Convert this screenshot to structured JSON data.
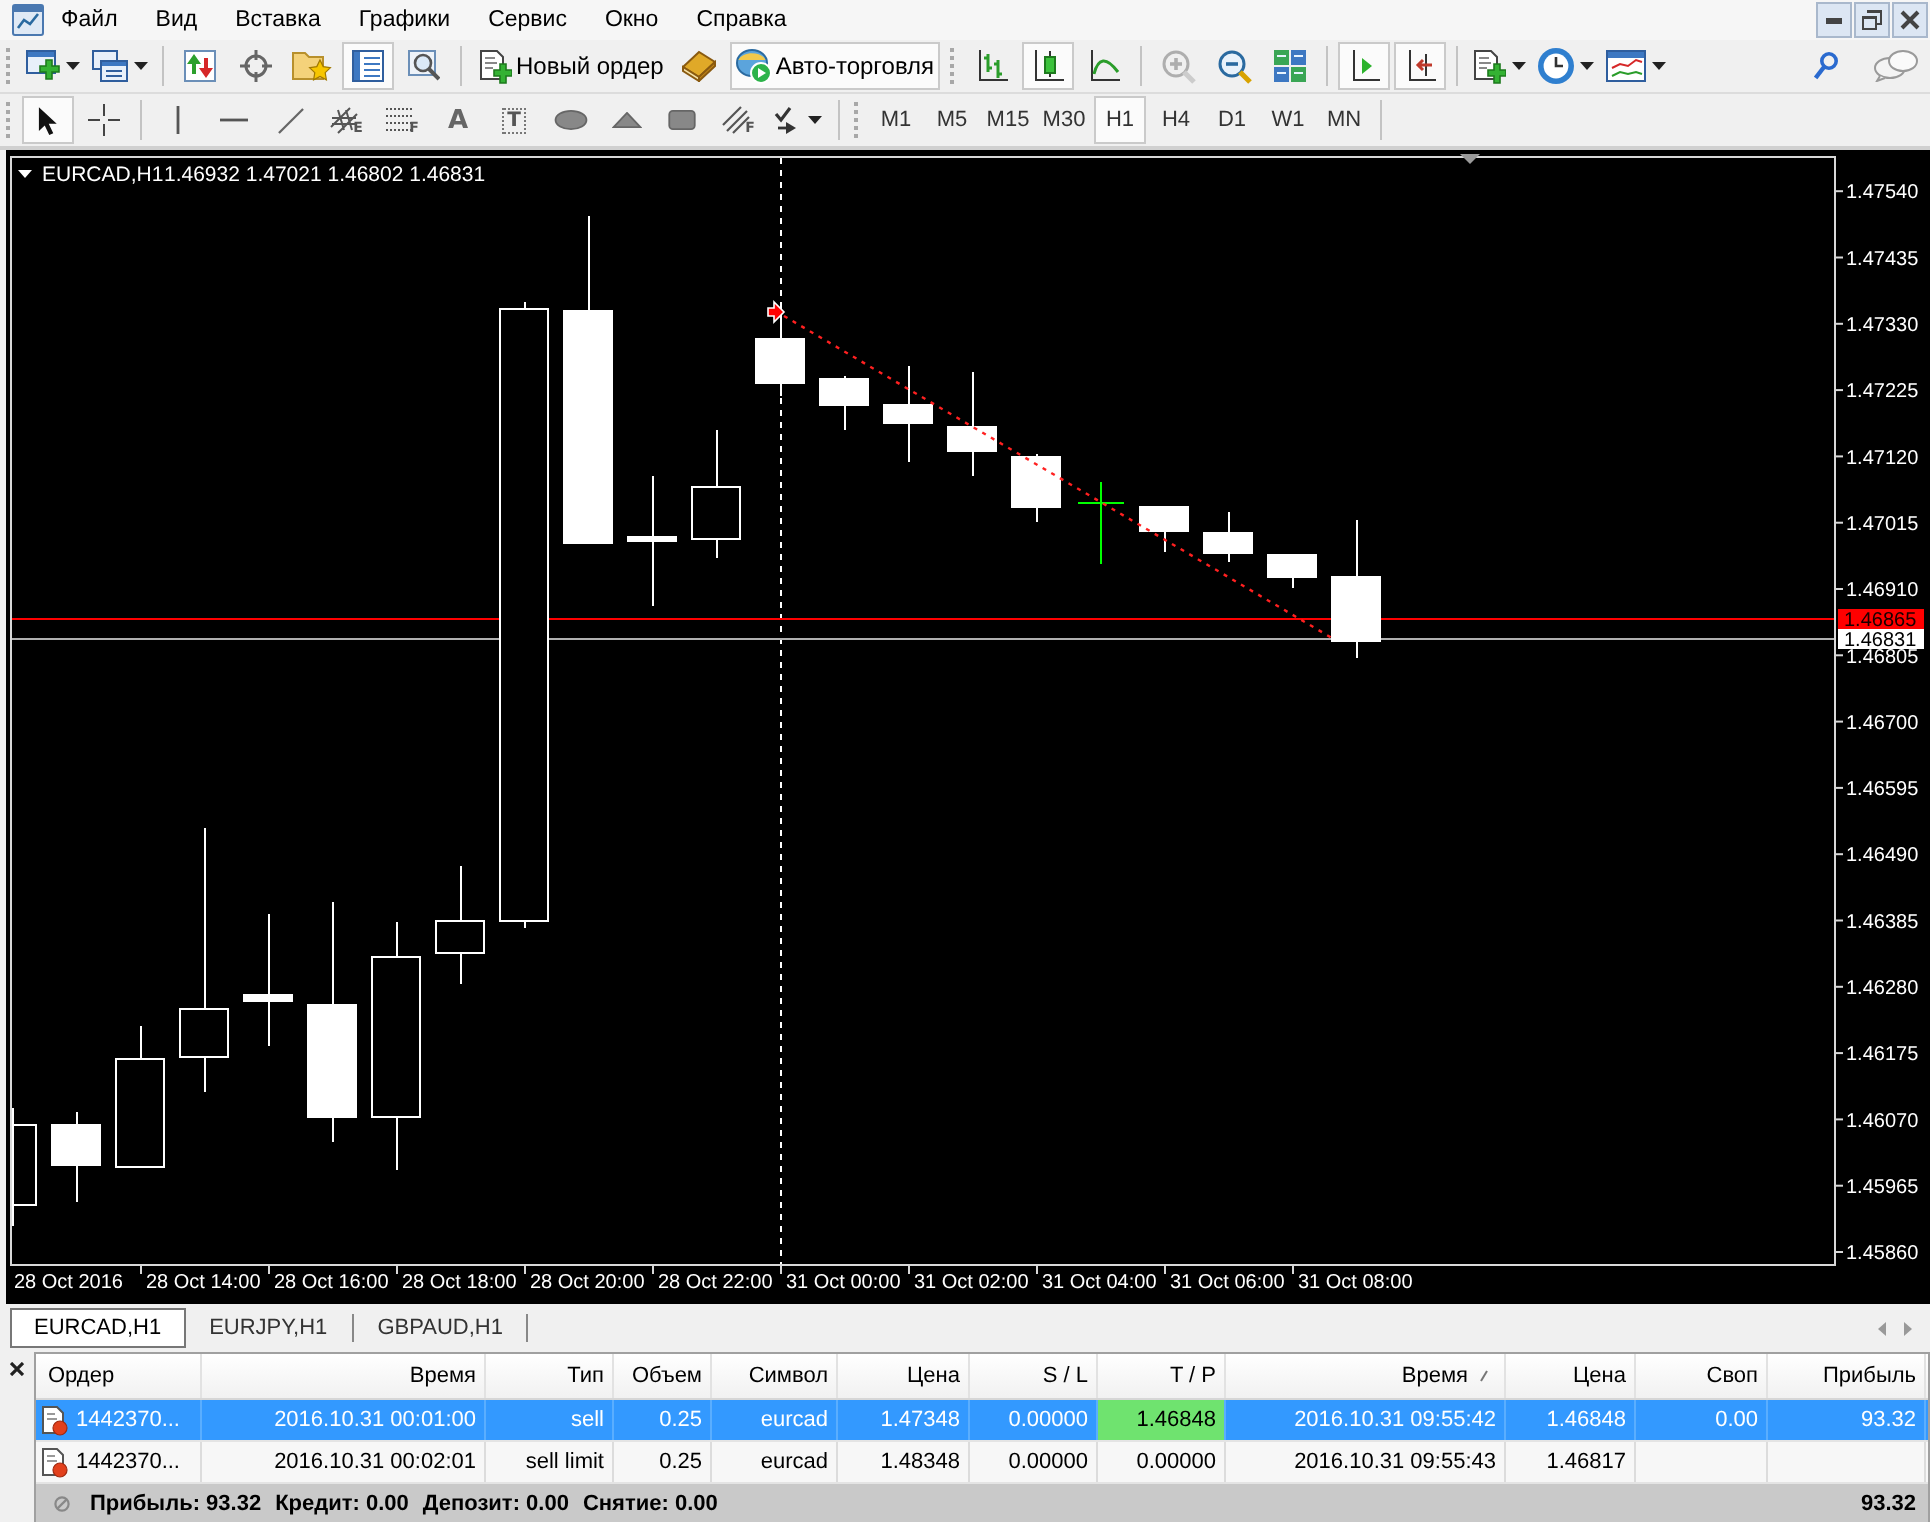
{
  "menu": [
    "Файл",
    "Вид",
    "Вставка",
    "Графики",
    "Сервис",
    "Окно",
    "Справка"
  ],
  "toolbar": {
    "items": [
      {
        "pressed": false,
        "disabled": false
      },
      {
        "pressed": false,
        "disabled": false
      },
      {
        "pressed": false,
        "disabled": false
      },
      {
        "pressed": false,
        "disabled": false
      },
      {
        "pressed": false,
        "disabled": false
      },
      {
        "pressed": true,
        "disabled": false
      },
      {
        "pressed": false,
        "disabled": false
      },
      {
        "label": "Новый ордер",
        "pressed": false,
        "disabled": false
      },
      {
        "pressed": false,
        "disabled": false
      },
      {
        "label": "Авто-торговля",
        "pressed": true,
        "disabled": false
      },
      {
        "pressed": false,
        "disabled": false
      },
      {
        "pressed": true,
        "disabled": false
      },
      {
        "pressed": false,
        "disabled": false
      },
      {
        "pressed": false,
        "disabled": true
      },
      {
        "pressed": false,
        "disabled": false
      },
      {
        "pressed": false,
        "disabled": false
      },
      {
        "pressed": true,
        "disabled": false
      },
      {
        "pressed": true,
        "disabled": false
      },
      {
        "pressed": false,
        "disabled": false
      },
      {
        "pressed": false,
        "disabled": false
      },
      {
        "pressed": false,
        "disabled": false
      }
    ]
  },
  "drawing_toolbar": {
    "items": [
      {
        "pressed": true
      },
      {
        "pressed": false
      },
      {
        "pressed": false
      },
      {
        "pressed": false
      },
      {
        "pressed": false
      },
      {
        "label": "E",
        "pressed": false
      },
      {
        "label": "F",
        "pressed": false
      },
      {
        "label": "A",
        "pressed": false
      },
      {
        "label": "T",
        "pressed": false
      },
      {
        "pressed": false
      },
      {
        "pressed": false
      },
      {
        "pressed": false
      },
      {
        "label": "F",
        "pressed": false
      },
      {
        "pressed": false
      }
    ]
  },
  "timeframes": [
    {
      "label": "M1",
      "selected": false
    },
    {
      "label": "M5",
      "selected": false
    },
    {
      "label": "M15",
      "selected": false
    },
    {
      "label": "M30",
      "selected": false
    },
    {
      "label": "H1",
      "selected": true
    },
    {
      "label": "H4",
      "selected": false
    },
    {
      "label": "D1",
      "selected": false
    },
    {
      "label": "W1",
      "selected": false
    },
    {
      "label": "MN",
      "selected": false
    }
  ],
  "chart": {
    "symbol": "EURCAD,H1",
    "ohlc": "1.46932 1.47021 1.46802 1.46831",
    "price_labels": [
      "1.47540",
      "1.47435",
      "1.47330",
      "1.47225",
      "1.47120",
      "1.47015",
      "1.46910",
      "1.46805",
      "1.46700",
      "1.46595",
      "1.46490",
      "1.46385",
      "1.46280",
      "1.46175",
      "1.46070",
      "1.45965",
      "1.45860"
    ],
    "price_tags": [
      {
        "text": "1.46865",
        "kind": "ask"
      },
      {
        "text": "1.46831",
        "kind": "bid"
      }
    ],
    "time_labels": [
      "28 Oct 2016",
      "28 Oct 14:00",
      "28 Oct 16:00",
      "28 Oct 18:00",
      "28 Oct 20:00",
      "28 Oct 22:00",
      "31 Oct 00:00",
      "31 Oct 02:00",
      "31 Oct 04:00",
      "31 Oct 06:00",
      "31 Oct 08:00"
    ]
  },
  "tabs": [
    {
      "label": "EURCAD,H1",
      "selected": true
    },
    {
      "label": "EURJPY,H1",
      "selected": false
    },
    {
      "label": "GBPAUD,H1",
      "selected": false
    }
  ],
  "terminal": {
    "columns": [
      {
        "label": "Ордер",
        "sorted": false
      },
      {
        "label": "Время",
        "sorted": false
      },
      {
        "label": "Тип",
        "sorted": false
      },
      {
        "label": "Объем",
        "sorted": false
      },
      {
        "label": "Символ",
        "sorted": false
      },
      {
        "label": "Цена",
        "sorted": false
      },
      {
        "label": "S / L",
        "sorted": false
      },
      {
        "label": "T / P",
        "sorted": false
      },
      {
        "label": "Время",
        "sorted": true
      },
      {
        "label": "Цена",
        "sorted": false
      },
      {
        "label": "Своп",
        "sorted": false
      },
      {
        "label": "Прибыль",
        "sorted": false
      }
    ],
    "rows": [
      {
        "order": "1442370...",
        "open_time": "2016.10.31 00:01:00",
        "type": "sell",
        "volume": "0.25",
        "symbol": "eurcad",
        "price": "1.47348",
        "sl": "0.00000",
        "tp": "1.46848",
        "tp_highlighted": true,
        "time": "2016.10.31 09:55:42",
        "current_price": "1.46848",
        "swap": "0.00",
        "profit": "93.32",
        "selected": true
      },
      {
        "order": "1442370...",
        "open_time": "2016.10.31 00:02:01",
        "type": "sell limit",
        "volume": "0.25",
        "symbol": "eurcad",
        "price": "1.48348",
        "sl": "0.00000",
        "tp": "0.00000",
        "tp_highlighted": false,
        "time": "2016.10.31 09:55:43",
        "current_price": "1.46817",
        "selected": false
      }
    ],
    "summary": {
      "items": [
        "Прибыль: 93.32",
        "Кредит: 0.00",
        "Депозит: 0.00",
        "Снятие: 0.00"
      ],
      "total": "93.32"
    }
  }
}
